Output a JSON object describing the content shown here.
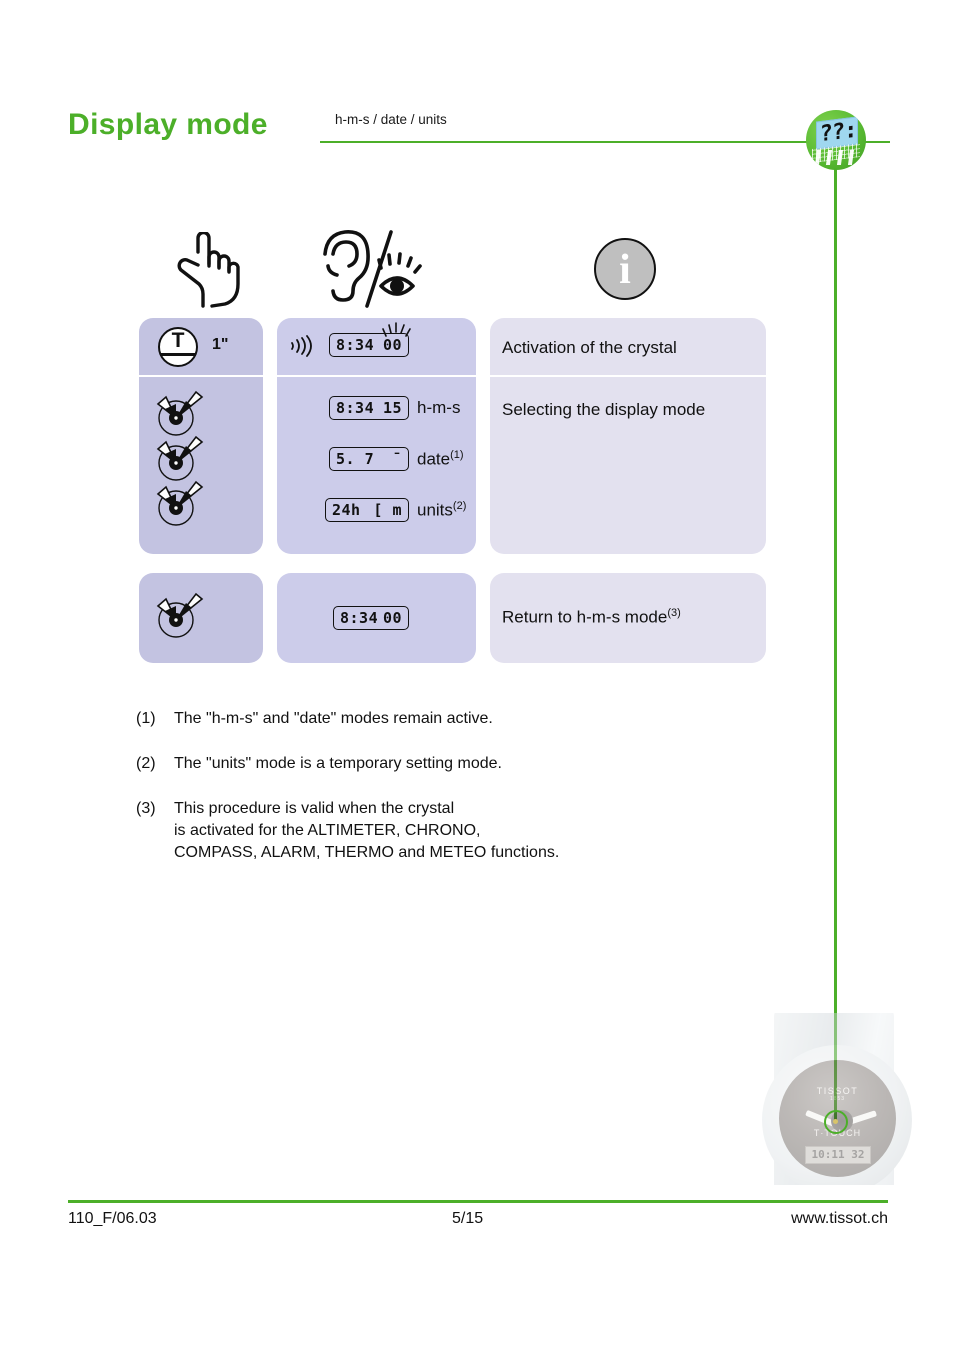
{
  "header": {
    "title": "Display  mode",
    "subtitle": "h-m-s / date / units",
    "accent_color": "#4caf29"
  },
  "badge": {
    "name": "display-mode-watch-badge",
    "lcd_text": "??:"
  },
  "pictograms": [
    {
      "name": "pointing-hand-icon",
      "meaning": "touch / press"
    },
    {
      "name": "ear-eye-icon",
      "meaning": "hear / see"
    },
    {
      "name": "info-icon",
      "glyph": "i",
      "meaning": "information"
    }
  ],
  "table": {
    "blocks": [
      {
        "rows": [
          {
            "action": {
              "icon": "t-button-icon",
              "letter": "T",
              "duration": "1\""
            },
            "feedback": {
              "sound_icon": "sound-waves-icon",
              "lcd_left": "8:34",
              "lcd_right": "00",
              "flash": true
            },
            "description": "Activation of the crystal"
          },
          {
            "action": {
              "icon": "watch-hands-icon",
              "repeat": 3
            },
            "feedback_list": [
              {
                "lcd_left": "8:34",
                "lcd_right": "15",
                "label": "h-m-s",
                "note": ""
              },
              {
                "lcd_left": "5. 7",
                "lcd_right": "¯",
                "label": "date",
                "note": "(1)"
              },
              {
                "lcd_left": "24h",
                "lcd_right": "[ m",
                "label": "units",
                "note": "(2)"
              }
            ],
            "description": "Selecting the display mode"
          }
        ]
      },
      {
        "rows": [
          {
            "action": {
              "icon": "watch-hands-icon",
              "repeat": 1
            },
            "feedback": {
              "lcd_left": "8:34",
              "lcd_right": "00",
              "flash": false
            },
            "description": "Return to h-m-s mode",
            "description_note": "(3)"
          }
        ]
      }
    ]
  },
  "footnotes": [
    {
      "num": "(1)",
      "text": "The \"h-m-s\" and \"date\" modes remain active."
    },
    {
      "num": "(2)",
      "text": "The \"units\" mode is a temporary setting mode."
    },
    {
      "num": "(3)",
      "text": "This procedure is valid when the crystal\nis activated for the ALTIMETER, CHRONO,\nCOMPASS, ALARM, THERMO and METEO functions."
    }
  ],
  "watch_photo": {
    "brand": "TISSOT",
    "brand_sub": "1853",
    "model": "T·TOUCH",
    "sub_lcd": "10:11  32"
  },
  "footer": {
    "left": "110_F/06.03",
    "center": "5/15",
    "right": "www.tissot.ch"
  }
}
